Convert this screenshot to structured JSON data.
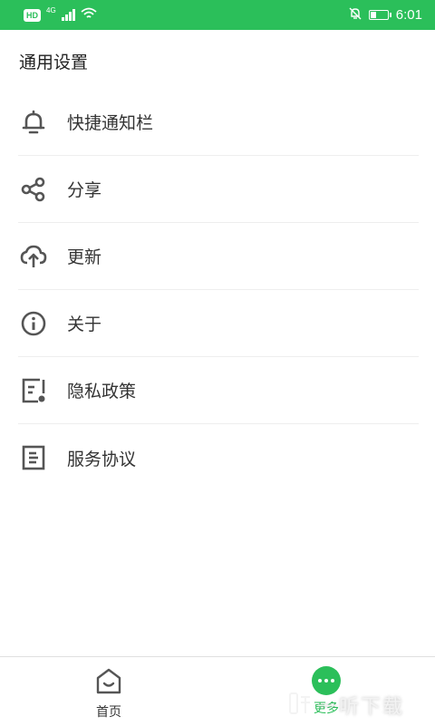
{
  "status_bar": {
    "hd": "HD",
    "network": "4G",
    "time": "6:01",
    "battery_level": 0.3
  },
  "page": {
    "title": "通用设置"
  },
  "menu": {
    "items": [
      {
        "label": "快捷通知栏",
        "icon": "bell-icon"
      },
      {
        "label": "分享",
        "icon": "share-icon"
      },
      {
        "label": "更新",
        "icon": "cloud-upload-icon"
      },
      {
        "label": "关于",
        "icon": "info-icon"
      },
      {
        "label": "隐私政策",
        "icon": "privacy-document-icon"
      },
      {
        "label": "服务协议",
        "icon": "agreement-document-icon"
      }
    ]
  },
  "bottom_nav": {
    "home_label": "首页",
    "more_label": "更多",
    "active_color": "#2bbf5a"
  },
  "watermark": {
    "text": "一听下载"
  },
  "colors": {
    "brand": "#2bbf5a",
    "icon": "#555555"
  }
}
